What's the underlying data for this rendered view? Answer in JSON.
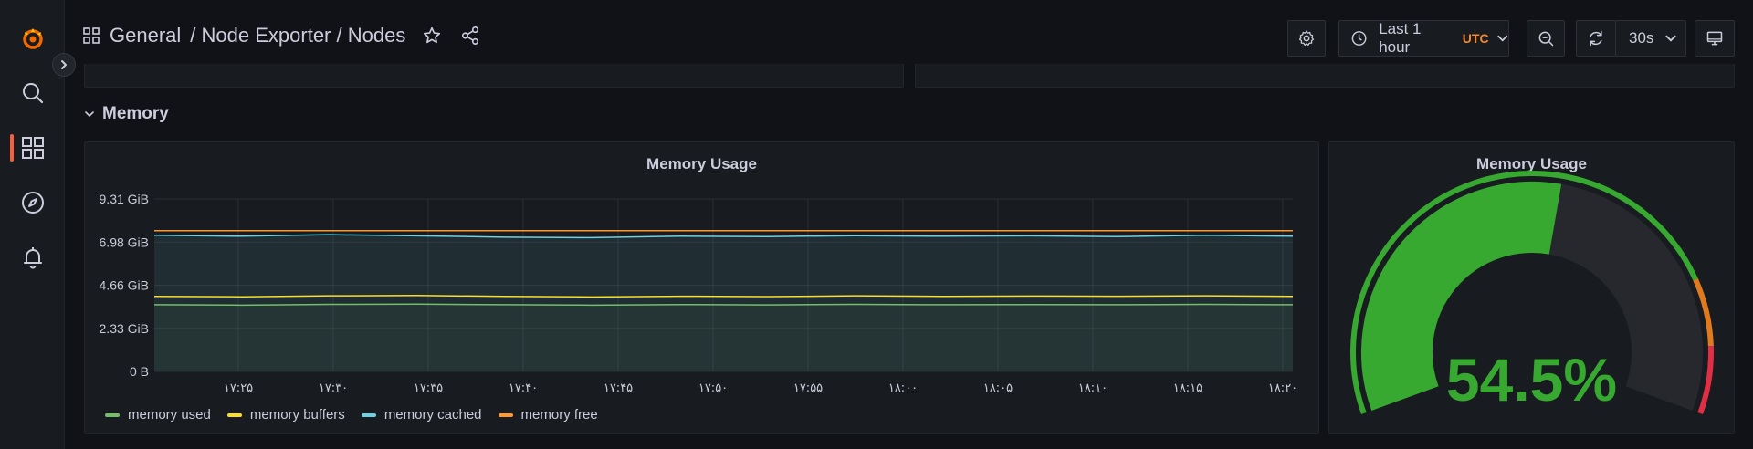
{
  "sidebar": {
    "items": [
      {
        "name": "grafana-logo",
        "icon": "grafana-logo"
      },
      {
        "name": "search",
        "icon": "search-icon"
      },
      {
        "name": "dashboards",
        "icon": "dashboards-grid-icon",
        "active": true
      },
      {
        "name": "explore",
        "icon": "compass-icon"
      },
      {
        "name": "alerting",
        "icon": "bell-icon"
      }
    ]
  },
  "header": {
    "breadcrumb": {
      "root": "General",
      "sep1": "/",
      "folder": "Node Exporter",
      "sep2": "/",
      "title": "Nodes"
    },
    "time_range": "Last 1 hour",
    "timezone": "UTC",
    "refresh_interval": "30s"
  },
  "row": {
    "title": "Memory"
  },
  "timeseries_panel": {
    "title": "Memory Usage"
  },
  "gauge_panel": {
    "title": "Memory Usage",
    "value_text": "54.5%"
  },
  "colors": {
    "accent": "#f55f3e",
    "memory_used": "#73bf69",
    "memory_buffers": "#fade2a",
    "memory_cached": "#8ab8ff",
    "memory_cached_actual": "#6ed0e0",
    "memory_free": "#ff9830",
    "gauge_green": "#37a830",
    "gauge_orange": "#e07a1f",
    "gauge_red": "#e02f44"
  },
  "chart_data": [
    {
      "type": "line",
      "title": "Memory Usage",
      "y_tick_labels": [
        "0 B",
        "2.33 GiB",
        "4.66 GiB",
        "6.98 GiB",
        "9.31 GiB"
      ],
      "ylim": [
        0,
        9.31
      ],
      "y_unit": "GiB",
      "x_tick_labels": [
        "۱۷:۲۵",
        "۱۷:۳۰",
        "۱۷:۳۵",
        "۱۷:۴۰",
        "۱۷:۴۵",
        "۱۷:۵۰",
        "۱۷:۵۵",
        "۱۸:۰۰",
        "۱۸:۰۵",
        "۱۸:۱۰",
        "۱۸:۱۵",
        "۱۸:۲۰"
      ],
      "grid": true,
      "legend_position": "bottom-left",
      "series": [
        {
          "name": "memory used",
          "color": "#73bf69",
          "values": [
            3.6,
            3.58,
            3.62,
            3.63,
            3.6,
            3.58,
            3.61,
            3.59,
            3.62,
            3.6,
            3.61,
            3.6,
            3.62,
            3.6
          ]
        },
        {
          "name": "memory buffers",
          "color": "#fade2a",
          "values": [
            4.05,
            4.03,
            4.08,
            4.1,
            4.05,
            4.02,
            4.06,
            4.04,
            4.08,
            4.05,
            4.07,
            4.06,
            4.08,
            4.05
          ]
        },
        {
          "name": "memory cached",
          "color": "#6ed0e0",
          "values": [
            7.35,
            7.3,
            7.38,
            7.32,
            7.25,
            7.22,
            7.3,
            7.28,
            7.33,
            7.3,
            7.32,
            7.28,
            7.35,
            7.3
          ]
        },
        {
          "name": "memory free",
          "color": "#ff9830",
          "values": [
            7.6,
            7.6,
            7.6,
            7.6,
            7.6,
            7.6,
            7.6,
            7.6,
            7.6,
            7.6,
            7.6,
            7.6,
            7.6,
            7.6
          ]
        }
      ]
    },
    {
      "type": "gauge",
      "title": "Memory Usage",
      "value": 54.5,
      "unit": "%",
      "min": 0,
      "max": 100,
      "thresholds": [
        {
          "from": 0,
          "color": "#37a830"
        },
        {
          "from": 80,
          "color": "#e07a1f"
        },
        {
          "from": 90,
          "color": "#e02f44"
        }
      ]
    }
  ]
}
